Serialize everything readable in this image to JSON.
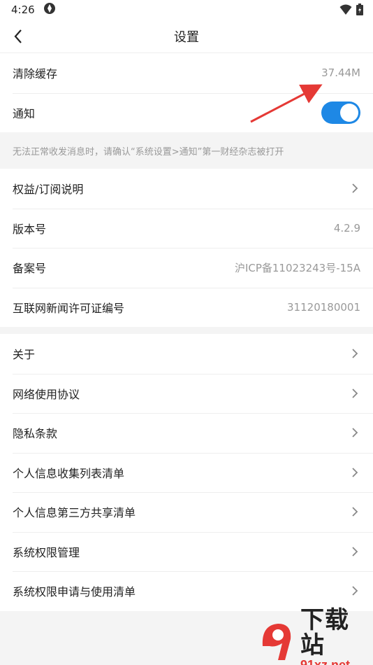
{
  "status_bar": {
    "time": "4:26"
  },
  "header": {
    "title": "设置"
  },
  "group1": {
    "clear_cache": {
      "label": "清除缓存",
      "value": "37.44M"
    },
    "notification": {
      "label": "通知",
      "enabled": true
    }
  },
  "note": "无法正常收发消息时，请确认“系统设置>通知”第一财经杂志被打开",
  "group2": [
    {
      "label": "权益/订阅说明",
      "value": ""
    },
    {
      "label": "版本号",
      "value": "4.2.9"
    },
    {
      "label": "备案号",
      "value": "沪ICP备11023243号-15A"
    },
    {
      "label": "互联网新闻许可证编号",
      "value": "31120180001"
    }
  ],
  "group3": [
    {
      "label": "关于"
    },
    {
      "label": "网络使用协议"
    },
    {
      "label": "隐私条款"
    },
    {
      "label": "个人信息收集列表清单"
    },
    {
      "label": "个人信息第三方共享清单"
    },
    {
      "label": "系统权限管理"
    },
    {
      "label": "系统权限申请与使用清单"
    }
  ],
  "watermark": {
    "big": "下载站",
    "small": "91xz.net"
  },
  "colors": {
    "toggle_on": "#1e88e5",
    "arrow": "#e53935"
  }
}
